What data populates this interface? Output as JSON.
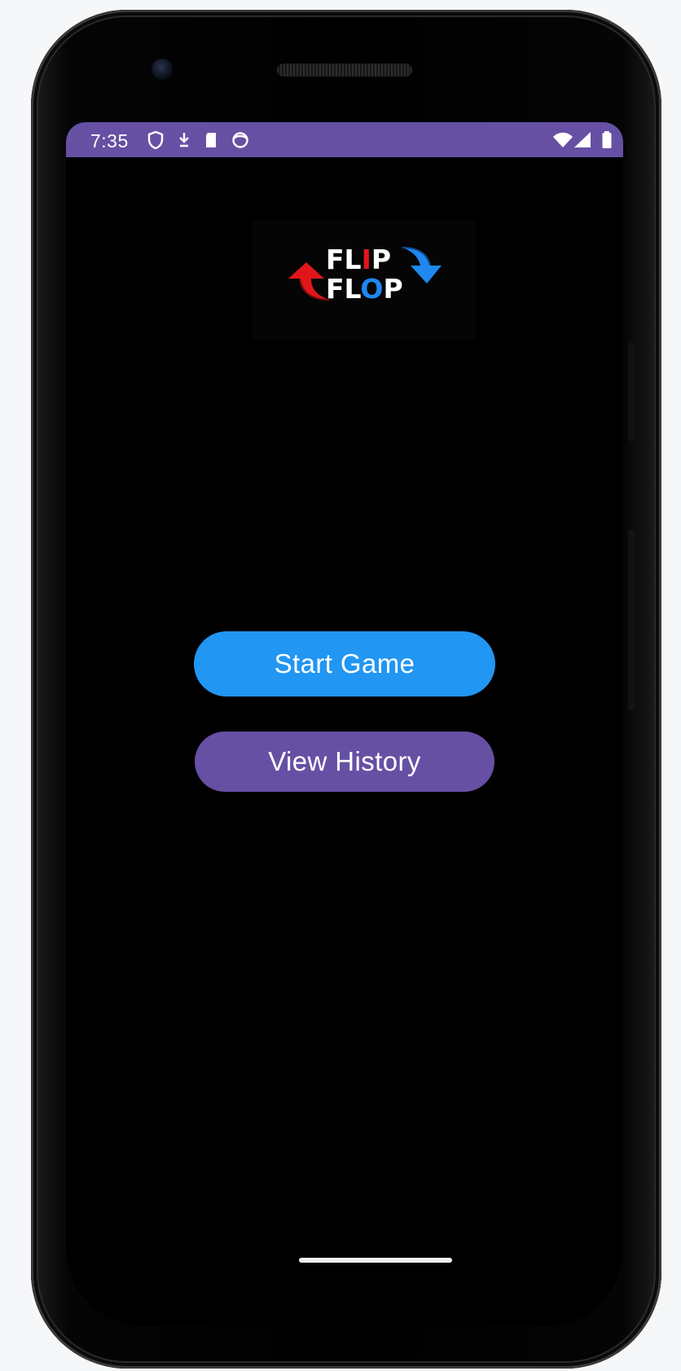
{
  "status_bar": {
    "time": "7:35",
    "background": "#6650a4",
    "left_icons": [
      "shield-icon",
      "download-icon",
      "sd-card-icon",
      "face-icon"
    ],
    "right_icons": [
      "wifi-icon",
      "signal-icon",
      "battery-icon"
    ]
  },
  "logo": {
    "word_top_prefix": "FL",
    "word_top_accent": "I",
    "word_top_suffix": "P",
    "word_bottom_prefix": "FL",
    "word_bottom_accent": "O",
    "word_bottom_suffix": "P",
    "red": "#e0161b",
    "blue": "#1e88f0",
    "icons": [
      "arrow-up-icon",
      "arrow-down-icon"
    ]
  },
  "buttons": {
    "start_label": "Start Game",
    "start_color": "#2196f3",
    "history_label": "View History",
    "history_color": "#6650a4"
  },
  "screen": {
    "background": "#000000"
  }
}
